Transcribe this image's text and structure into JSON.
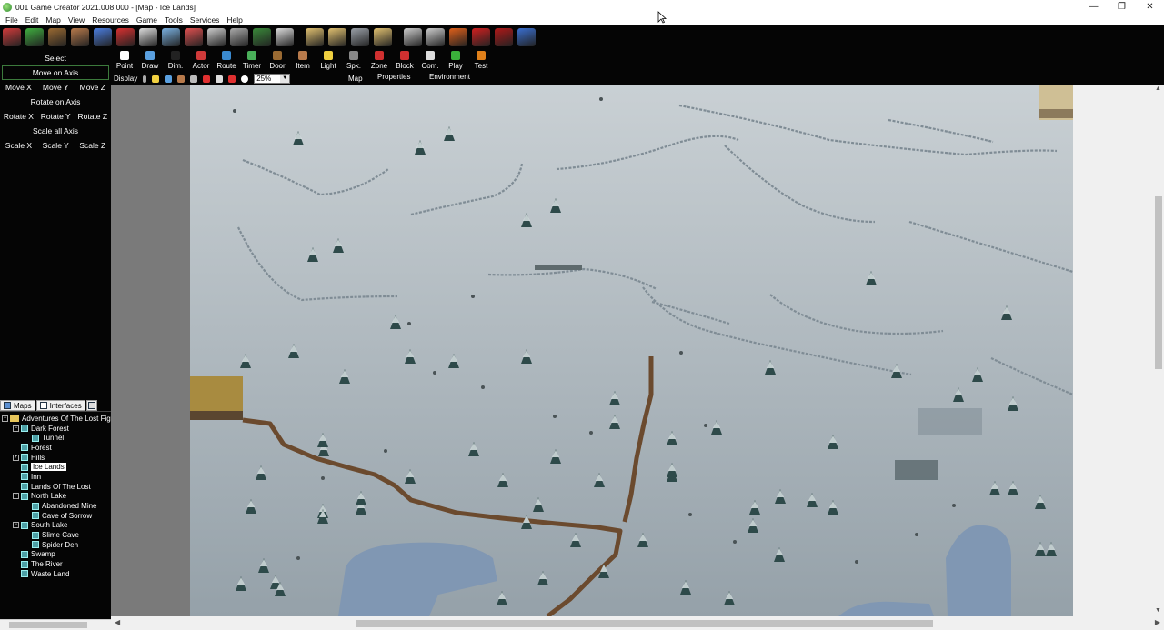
{
  "window": {
    "title": "001 Game Creator 2021.008.000 - [Map - Ice Lands]",
    "minimize": "—",
    "maximize": "❐",
    "close": "✕"
  },
  "menu": [
    "File",
    "Edit",
    "Map",
    "View",
    "Resources",
    "Game",
    "Tools",
    "Services",
    "Help"
  ],
  "toolbar_icons": [
    {
      "name": "actor-red-icon",
      "color": "#d23b3b"
    },
    {
      "name": "actor-green-icon",
      "color": "#3fae3f"
    },
    {
      "name": "door-icon",
      "color": "#9a6a32"
    },
    {
      "name": "item-bag-icon",
      "color": "#b87a4b"
    },
    {
      "name": "music-icon",
      "color": "#4b7ee0"
    },
    {
      "name": "font-icon",
      "color": "#d83030"
    },
    {
      "name": "character-icon",
      "color": "#dddddd"
    },
    {
      "name": "notebook-icon",
      "color": "#7ab0e0"
    },
    {
      "name": "group-icon",
      "color": "#e05050"
    },
    {
      "name": "table-icon",
      "color": "#cccccc"
    },
    {
      "name": "crowd-icon",
      "color": "#aaaaaa"
    },
    {
      "name": "tree-icon",
      "color": "#3a8a3a"
    },
    {
      "name": "xyz-icon",
      "color": "#dddddd"
    },
    {
      "name": "document-icon",
      "color": "#e0c070"
    },
    {
      "name": "scroll-icon",
      "color": "#e0c070"
    },
    {
      "name": "database-icon",
      "color": "#9aa0a8"
    },
    {
      "name": "list-icon",
      "color": "#e0c070"
    },
    {
      "name": "gamepad-icon",
      "color": "#cccccc"
    },
    {
      "name": "gear-icon",
      "color": "#cccccc"
    },
    {
      "name": "ball-icon",
      "color": "#e0601a"
    },
    {
      "name": "film-icon",
      "color": "#d02020"
    },
    {
      "name": "play-film-icon",
      "color": "#b01818"
    },
    {
      "name": "save-icon",
      "color": "#3a6fd0"
    }
  ],
  "left_panel": {
    "select": "Select",
    "move_on_axis": "Move on Axis",
    "move": [
      "Move X",
      "Move Y",
      "Move Z"
    ],
    "rotate_on_axis": "Rotate on Axis",
    "rotate": [
      "Rotate X",
      "Rotate Y",
      "Rotate Z"
    ],
    "scale_all_axis": "Scale all Axis",
    "scale": [
      "Scale X",
      "Scale Y",
      "Scale Z"
    ]
  },
  "tools": [
    {
      "label": "Point",
      "color": "#ffffff"
    },
    {
      "label": "Draw",
      "color": "#5aa0e0"
    },
    {
      "label": "Dim.",
      "color": "#222222"
    },
    {
      "label": "Actor",
      "color": "#d03a3a"
    },
    {
      "label": "Route",
      "color": "#3a8ad0"
    },
    {
      "label": "Timer",
      "color": "#4ab05a"
    },
    {
      "label": "Door",
      "color": "#9a6a32"
    },
    {
      "label": "Item",
      "color": "#b87a4b"
    },
    {
      "label": "Light",
      "color": "#f0d040"
    },
    {
      "label": "Spk.",
      "color": "#888888"
    },
    {
      "label": "Zone",
      "color": "#d03030"
    },
    {
      "label": "Block",
      "color": "#d03030"
    },
    {
      "label": "Com.",
      "color": "#dddddd"
    },
    {
      "label": "Play",
      "color": "#3ab03a"
    },
    {
      "label": "Test",
      "color": "#e0801a"
    }
  ],
  "display": {
    "label": "Display",
    "zoom": "25%",
    "map": "Map",
    "properties": "Properties",
    "environment": "Environment"
  },
  "tree": {
    "tabs": [
      "Maps",
      "Interfaces"
    ],
    "items": [
      {
        "label": "Adventures Of The Lost Fig",
        "level": 0,
        "type": "folder",
        "exp": "-"
      },
      {
        "label": "Dark Forest",
        "level": 1,
        "type": "map",
        "exp": "-"
      },
      {
        "label": "Tunnel",
        "level": 2,
        "type": "map",
        "exp": ""
      },
      {
        "label": "Forest",
        "level": 1,
        "type": "map",
        "exp": ""
      },
      {
        "label": "Hills",
        "level": 1,
        "type": "map",
        "exp": "+"
      },
      {
        "label": "Ice Lands",
        "level": 1,
        "type": "map",
        "exp": "",
        "selected": true
      },
      {
        "label": "Inn",
        "level": 1,
        "type": "map",
        "exp": ""
      },
      {
        "label": "Lands Of The Lost",
        "level": 1,
        "type": "map",
        "exp": ""
      },
      {
        "label": "North Lake",
        "level": 1,
        "type": "map",
        "exp": "-"
      },
      {
        "label": "Abandoned Mine",
        "level": 2,
        "type": "map",
        "exp": ""
      },
      {
        "label": "Cave of Sorrow",
        "level": 2,
        "type": "map",
        "exp": ""
      },
      {
        "label": "South Lake",
        "level": 1,
        "type": "map",
        "exp": "-"
      },
      {
        "label": "Slime Cave",
        "level": 2,
        "type": "map",
        "exp": ""
      },
      {
        "label": "Spider Den",
        "level": 2,
        "type": "map",
        "exp": ""
      },
      {
        "label": "Swamp",
        "level": 1,
        "type": "map",
        "exp": ""
      },
      {
        "label": "The River",
        "level": 1,
        "type": "map",
        "exp": ""
      },
      {
        "label": "Waste Land",
        "level": 1,
        "type": "map",
        "exp": ""
      }
    ]
  },
  "colors": {
    "dark_panel": "#050505",
    "snow_top": "#c9d0d4",
    "snow_bottom": "#95a1a9",
    "path": "#6b4a2e",
    "water": "#8097b3",
    "tree": "#2e4a4a"
  }
}
